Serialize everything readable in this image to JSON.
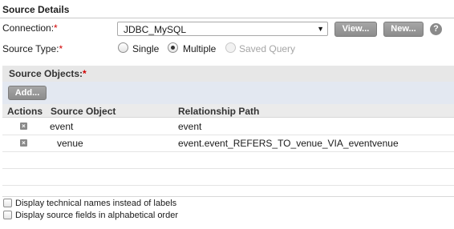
{
  "section": {
    "title": "Source Details"
  },
  "connection": {
    "label": "Connection:",
    "required_mark": "*",
    "selected": "JDBC_MySQL",
    "arrow_glyph": "▼",
    "view_button": "View...",
    "new_button": "New...",
    "help_glyph": "?"
  },
  "source_type": {
    "label": "Source Type:",
    "required_mark": "*",
    "options": [
      "Single",
      "Multiple",
      "Saved Query"
    ],
    "selected": "Multiple"
  },
  "source_objects": {
    "title": "Source Objects:",
    "required_mark": "*",
    "add_button": "Add...",
    "columns": [
      "Actions",
      "Source Object",
      "Relationship Path"
    ],
    "delete_glyph": "×",
    "rows": [
      {
        "object": "event",
        "path": "event"
      },
      {
        "object": "venue",
        "path": "event.event_REFERS_TO_venue_VIA_eventvenue"
      }
    ]
  },
  "options": {
    "technical_names": "Display technical names instead of labels",
    "alphabetical": "Display source fields in alphabetical order"
  }
}
